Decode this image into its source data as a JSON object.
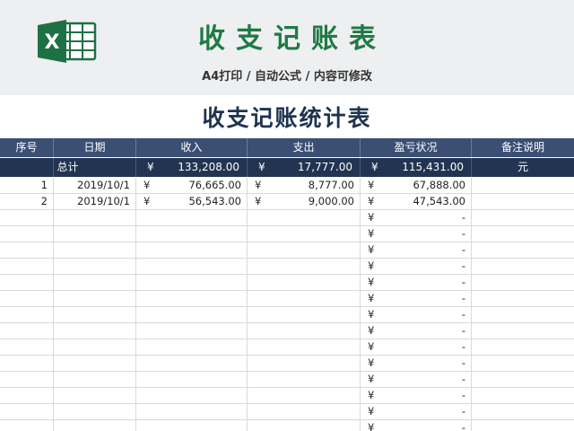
{
  "banner": {
    "title": "收支记账表",
    "subtitle": "A4打印 / 自动公式 / 内容可修改",
    "logo_letter": "X"
  },
  "sheet": {
    "title": "收支记账统计表",
    "columns": [
      "序号",
      "日期",
      "收入",
      "支出",
      "盈亏状况",
      "备注说明"
    ],
    "total": {
      "label": "总计",
      "income_cur": "¥",
      "income": "133,208.00",
      "expense_cur": "¥",
      "expense": "17,777.00",
      "profit_cur": "¥",
      "profit": "115,431.00",
      "note": "元"
    },
    "rows": [
      {
        "no": "1",
        "date": "2019/10/1",
        "income_cur": "¥",
        "income": "76,665.00",
        "expense_cur": "¥",
        "expense": "8,777.00",
        "profit_cur": "¥",
        "profit": "67,888.00"
      },
      {
        "no": "2",
        "date": "2019/10/1",
        "income_cur": "¥",
        "income": "56,543.00",
        "expense_cur": "¥",
        "expense": "9,000.00",
        "profit_cur": "¥",
        "profit": "47,543.00"
      },
      {
        "no": "",
        "date": "",
        "income_cur": "",
        "income": "",
        "expense_cur": "",
        "expense": "",
        "profit_cur": "¥",
        "profit": "-"
      },
      {
        "no": "",
        "date": "",
        "income_cur": "",
        "income": "",
        "expense_cur": "",
        "expense": "",
        "profit_cur": "¥",
        "profit": "-"
      },
      {
        "no": "",
        "date": "",
        "income_cur": "",
        "income": "",
        "expense_cur": "",
        "expense": "",
        "profit_cur": "¥",
        "profit": "-"
      },
      {
        "no": "",
        "date": "",
        "income_cur": "",
        "income": "",
        "expense_cur": "",
        "expense": "",
        "profit_cur": "¥",
        "profit": "-"
      },
      {
        "no": "",
        "date": "",
        "income_cur": "",
        "income": "",
        "expense_cur": "",
        "expense": "",
        "profit_cur": "¥",
        "profit": "-"
      },
      {
        "no": "",
        "date": "",
        "income_cur": "",
        "income": "",
        "expense_cur": "",
        "expense": "",
        "profit_cur": "¥",
        "profit": "-"
      },
      {
        "no": "",
        "date": "",
        "income_cur": "",
        "income": "",
        "expense_cur": "",
        "expense": "",
        "profit_cur": "¥",
        "profit": "-"
      },
      {
        "no": "",
        "date": "",
        "income_cur": "",
        "income": "",
        "expense_cur": "",
        "expense": "",
        "profit_cur": "¥",
        "profit": "-"
      },
      {
        "no": "",
        "date": "",
        "income_cur": "",
        "income": "",
        "expense_cur": "",
        "expense": "",
        "profit_cur": "¥",
        "profit": "-"
      },
      {
        "no": "",
        "date": "",
        "income_cur": "",
        "income": "",
        "expense_cur": "",
        "expense": "",
        "profit_cur": "¥",
        "profit": "-"
      },
      {
        "no": "",
        "date": "",
        "income_cur": "",
        "income": "",
        "expense_cur": "",
        "expense": "",
        "profit_cur": "¥",
        "profit": "-"
      },
      {
        "no": "",
        "date": "",
        "income_cur": "",
        "income": "",
        "expense_cur": "",
        "expense": "",
        "profit_cur": "¥",
        "profit": "-"
      },
      {
        "no": "",
        "date": "",
        "income_cur": "",
        "income": "",
        "expense_cur": "",
        "expense": "",
        "profit_cur": "¥",
        "profit": "-"
      },
      {
        "no": "",
        "date": "",
        "income_cur": "",
        "income": "",
        "expense_cur": "",
        "expense": "",
        "profit_cur": "¥",
        "profit": "-"
      }
    ]
  },
  "colors": {
    "title_green": "#1f7a45",
    "header_bg": "#3b4f74",
    "total_bg": "#223452",
    "excel_green": "#1e7145"
  },
  "icons": {
    "logo": "excel-logo-icon"
  }
}
